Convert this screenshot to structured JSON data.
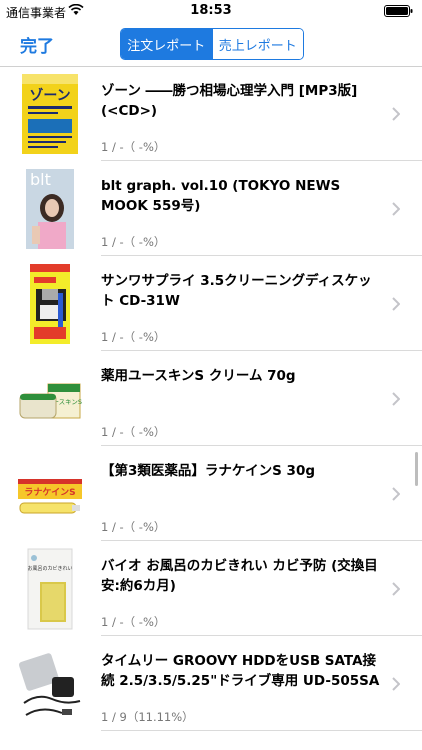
{
  "status_bar": {
    "carrier": "通信事業者",
    "time": "18:53",
    "icons": [
      "wifi-icon",
      "battery-icon"
    ]
  },
  "nav": {
    "done_label": "完了",
    "segments": [
      {
        "label": "注文レポート",
        "selected": true
      },
      {
        "label": "売上レポート",
        "selected": false
      }
    ],
    "accent_color": "#1e7ae0"
  },
  "items": [
    {
      "title": "ゾーン ――勝つ相場心理学入門 [MP3版] (<CD>)",
      "stat": "1 / -（ -%）"
    },
    {
      "title": "blt graph. vol.10 (TOKYO NEWS MOOK 559号)",
      "stat": "1 / -（ -%）"
    },
    {
      "title": "サンワサプライ 3.5クリーニングディスケット CD-31W",
      "stat": "1 / -（ -%）"
    },
    {
      "title": "薬用ユースキンS クリーム 70g",
      "stat": "1 / -（ -%）"
    },
    {
      "title": "【第3類医薬品】ラナケインS 30g",
      "stat": "1 / -（ -%）"
    },
    {
      "title": "バイオ お風呂のカビきれい カビ予防 (交換目安:約6カ月)",
      "stat": "1 / -（ -%）"
    },
    {
      "title": "タイムリー GROOVY HDDをUSB SATA接続 2.5/3.5/5.25\"ドライブ専用 UD-505SA",
      "stat": "1 / 9（11.11%）"
    }
  ],
  "thumb_texts": {
    "book_title": "ゾーン",
    "magazine_title": "blt",
    "cream_label": "ユースキンS",
    "ointment_label": "ラナケインS",
    "bath_label": "お風呂のカビきれい"
  }
}
